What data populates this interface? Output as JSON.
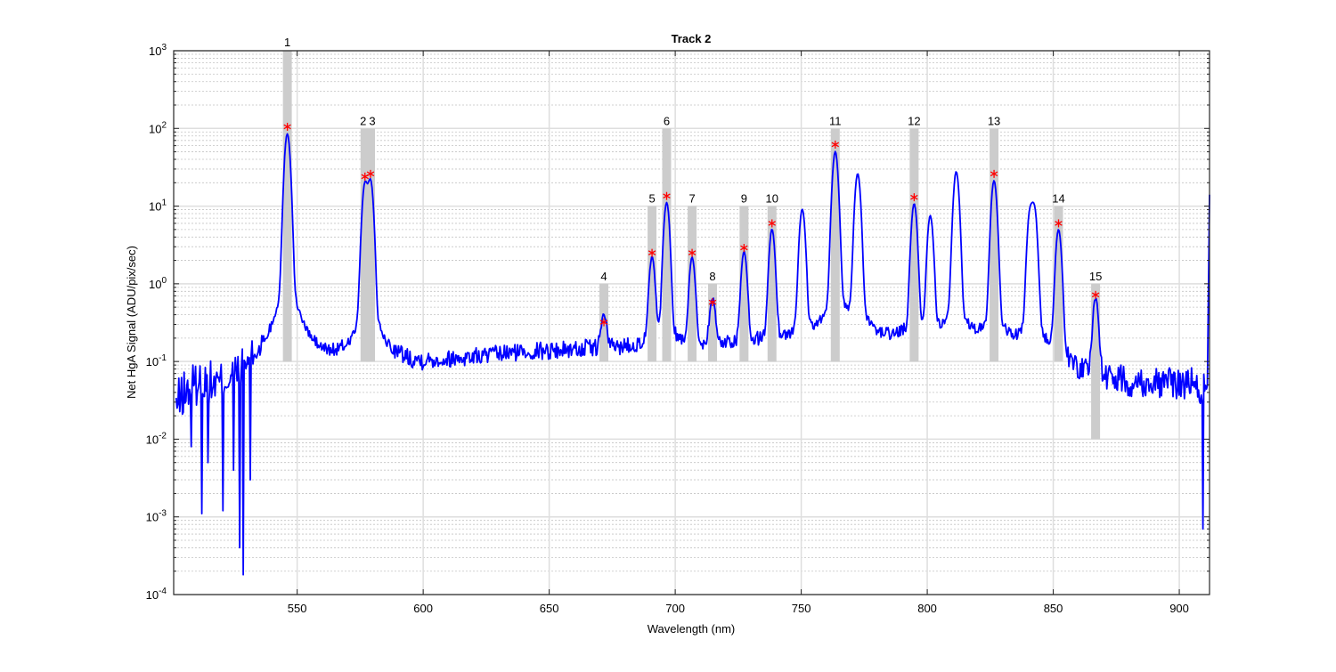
{
  "chart_data": {
    "type": "line",
    "title": "Track 2",
    "xlabel": "Wavelength (nm)",
    "ylabel": "Net HgA Signal (ADU/pix/sec)",
    "xlim": [
      501,
      912
    ],
    "ylim": [
      0.0001,
      1000
    ],
    "yscale": "log",
    "grid": true,
    "minor_grid": true,
    "x_ticks": [
      550,
      600,
      650,
      700,
      750,
      800,
      850,
      900
    ],
    "x_tick_labels": [
      "550",
      "600",
      "650",
      "700",
      "750",
      "800",
      "850",
      "900"
    ],
    "y_ticks": [
      0.0001,
      0.001,
      0.01,
      0.1,
      1,
      10,
      100,
      1000
    ],
    "y_tick_labels": [
      {
        "base": "10",
        "exp": "-4"
      },
      {
        "base": "10",
        "exp": "-3"
      },
      {
        "base": "10",
        "exp": "-2"
      },
      {
        "base": "10",
        "exp": "-1"
      },
      {
        "base": "10",
        "exp": "0"
      },
      {
        "base": "10",
        "exp": "1"
      },
      {
        "base": "10",
        "exp": "2"
      },
      {
        "base": "10",
        "exp": "3"
      }
    ],
    "colors": {
      "series": "#0000ff",
      "marker": "#ff0000",
      "window": "#cccccc",
      "grid_major": "#dedede",
      "grid_minor": "#c4c4c4"
    },
    "spectrum": {
      "baseline": [
        [
          502,
          0.02
        ],
        [
          505,
          0.03
        ],
        [
          510,
          0.04
        ],
        [
          520,
          0.035
        ],
        [
          530,
          0.05
        ],
        [
          540,
          0.08
        ],
        [
          550,
          0.1
        ],
        [
          560,
          0.08
        ],
        [
          580,
          0.09
        ],
        [
          600,
          0.09
        ],
        [
          620,
          0.11
        ],
        [
          640,
          0.13
        ],
        [
          660,
          0.14
        ],
        [
          680,
          0.15
        ],
        [
          700,
          0.15
        ],
        [
          720,
          0.16
        ],
        [
          740,
          0.16
        ],
        [
          760,
          0.16
        ],
        [
          780,
          0.17
        ],
        [
          800,
          0.17
        ],
        [
          820,
          0.16
        ],
        [
          840,
          0.13
        ],
        [
          850,
          0.11
        ],
        [
          860,
          0.06
        ],
        [
          880,
          0.05
        ],
        [
          900,
          0.05
        ],
        [
          905,
          0.05
        ],
        [
          908,
          0.04
        ],
        [
          912,
          0.05
        ]
      ],
      "peaks": [
        [
          546.1,
          105
        ],
        [
          576.9,
          24
        ],
        [
          579.1,
          26
        ],
        [
          671.7,
          0.32
        ],
        [
          690.8,
          2.5
        ],
        [
          696.6,
          13.5
        ],
        [
          706.7,
          2.5
        ],
        [
          714.8,
          0.6
        ],
        [
          727.3,
          3.0
        ],
        [
          738.4,
          6.0
        ],
        [
          750.4,
          11
        ],
        [
          763.5,
          62
        ],
        [
          772.4,
          32
        ],
        [
          794.8,
          13
        ],
        [
          801.2,
          9
        ],
        [
          811.5,
          34
        ],
        [
          826.5,
          26
        ],
        [
          840.8,
          10
        ],
        [
          842.5,
          11
        ],
        [
          852.1,
          6.0
        ],
        [
          866.8,
          0.72
        ]
      ],
      "dips": [
        [
          507.8,
          0.008
        ],
        [
          512.2,
          0.0011
        ],
        [
          514.6,
          0.005
        ],
        [
          520.4,
          0.0012
        ],
        [
          524.7,
          0.004
        ],
        [
          527.3,
          0.0004
        ],
        [
          528.6,
          0.00018
        ],
        [
          531.5,
          0.003
        ],
        [
          909.5,
          0.0007
        ]
      ],
      "end_rise": [
        [
          911.5,
          0.5
        ],
        [
          912,
          14
        ]
      ]
    },
    "lines": [
      {
        "label": "1",
        "x": 546.1,
        "y": 105
      },
      {
        "label": "2",
        "x": 576.9,
        "y": 24
      },
      {
        "label": "3",
        "x": 579.1,
        "y": 26
      },
      {
        "label": "4",
        "x": 671.7,
        "y": 0.32
      },
      {
        "label": "5",
        "x": 690.8,
        "y": 2.5
      },
      {
        "label": "6",
        "x": 696.6,
        "y": 13.5
      },
      {
        "label": "7",
        "x": 706.7,
        "y": 2.5
      },
      {
        "label": "8",
        "x": 714.8,
        "y": 0.58
      },
      {
        "label": "9",
        "x": 727.3,
        "y": 2.9
      },
      {
        "label": "10",
        "x": 738.4,
        "y": 6.0
      },
      {
        "label": "11",
        "x": 763.5,
        "y": 62
      },
      {
        "label": "12",
        "x": 794.8,
        "y": 13
      },
      {
        "label": "13",
        "x": 826.5,
        "y": 26
      },
      {
        "label": "14",
        "x": 852.1,
        "y": 6.0
      },
      {
        "label": "15",
        "x": 866.8,
        "y": 0.72
      }
    ]
  }
}
